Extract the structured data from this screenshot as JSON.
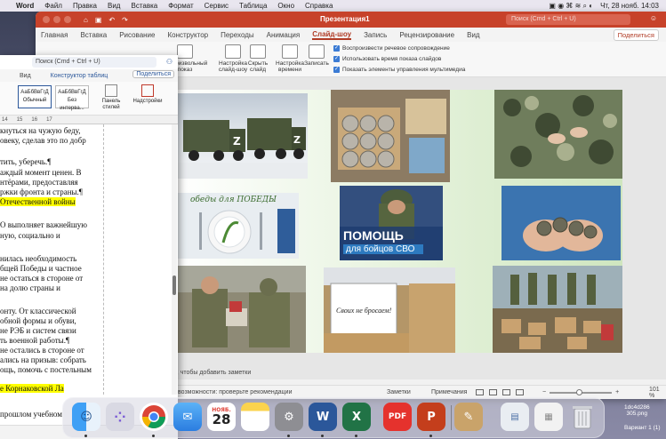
{
  "menubar": {
    "app": "Word",
    "items": [
      "Файл",
      "Правка",
      "Вид",
      "Вставка",
      "Формат",
      "Сервис",
      "Таблица",
      "Окно",
      "Справка"
    ],
    "datetime": "Чт, 28 нояб.  14:03"
  },
  "ppt": {
    "title": "Презентация1",
    "search_placeholder": "Поиск (Cmd + Ctrl + U)",
    "tabs": [
      "Главная",
      "Вставка",
      "Рисование",
      "Конструктор",
      "Переходы",
      "Анимация",
      "Слайд-шоу",
      "Запись",
      "Рецензирование",
      "Вид"
    ],
    "active_tab": "Слайд-шоу",
    "share": "Поделиться",
    "ribbon": {
      "custom_show": "произвольный показ",
      "setup": "Настройка слайд-шоу",
      "hide": "Скрыть слайд",
      "rehearse": "Настройка времени",
      "record": "Записать",
      "checks": [
        "Воспроизвести речевое сопровождение",
        "Использовать время показа слайдов",
        "Показать элементы управления мультимедиа"
      ]
    },
    "slide": {
      "badge_title": "ПОМОЩЬ",
      "badge_sub": "для бойцов СВО",
      "plate_text": "обеды для ПОБЕДЫ",
      "box_sign": "Своих не бросаем!"
    },
    "notes_hint": "у, чтобы добавить заметки",
    "status": {
      "accessibility": "возможности: проверьте рекомендации",
      "notes": "Заметки",
      "comments": "Примечания",
      "zoom": "101 %"
    }
  },
  "word": {
    "search_placeholder": "Поиск (Cmd + Ctrl + U)",
    "tab_view": "Вид",
    "tab_table": "Конструктор таблиц",
    "share": "Поделиться",
    "styles": [
      {
        "sample": "АаБбВвГгД",
        "name": "Обычный"
      },
      {
        "sample": "АаБбВвГгД",
        "name": "Без интерва..."
      }
    ],
    "styles_pane": "Панель стилей",
    "dictate": "Надстройки",
    "ruler": [
      "14",
      "15",
      "16",
      "17"
    ],
    "lines": [
      "кнуться на чужую беду,",
      "овеку, сделав это по добр",
      "",
      "тить, уберечь.¶",
      "аждый момент ценен. В",
      "нтёрами, предоставляя",
      "ржки фронта и страны.¶",
      "Отечественной войны",
      "",
      "О выполняет важнейшую",
      "ную, социально и",
      "",
      "нилась необходимость",
      "бщей Победы и частное",
      "не остаться в стороне от",
      "на долю страны и",
      "",
      "онту. От классической",
      "обной формы и обуви,",
      "не РЭБ и систем связи",
      "ть военной работы.¶",
      "не остались в стороне от",
      "ались на призыв: собрать",
      "ощь, помочь с постельным",
      "",
      "е Корнаковской Ла",
      "прошлом учебном",
      "..."
    ]
  },
  "dock": {
    "calendar_month": "НОЯБ.",
    "calendar_day": "28",
    "apps": [
      "finder-icon",
      "launchpad-icon",
      "chrome-icon",
      "mail-icon",
      "calendar-icon",
      "notes-icon",
      "settings-icon",
      "word-icon",
      "excel-icon",
      "pdf-icon",
      "powerpoint-icon",
      "preview-icon",
      "downloads-icon",
      "files-icon",
      "trash-icon"
    ]
  },
  "desktop": {
    "file1": "1dc4d286",
    "file1b": "305.png",
    "file2": "Вариант 1 (1)"
  }
}
